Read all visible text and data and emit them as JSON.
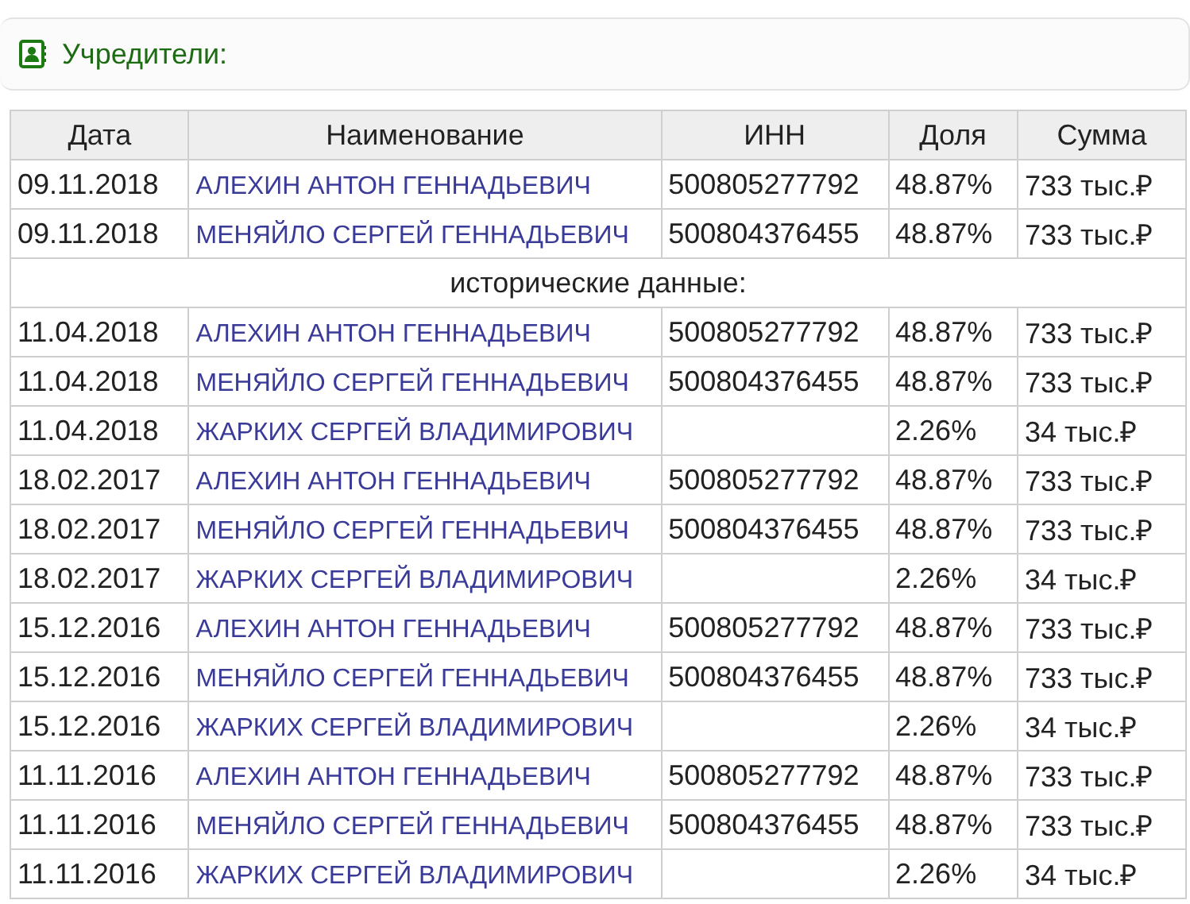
{
  "section": {
    "title": "Учредители:"
  },
  "table": {
    "columns": [
      "Дата",
      "Наименование",
      "ИНН",
      "Доля",
      "Сумма"
    ],
    "rows": [
      {
        "kind": "row",
        "date": "09.11.2018",
        "name": "АЛЕХИН АНТОН ГЕННАДЬЕВИЧ",
        "inn": "500805277792",
        "share": "48.87%",
        "sum": "733 тыс.₽"
      },
      {
        "kind": "row",
        "date": "09.11.2018",
        "name": "МЕНЯЙЛО СЕРГЕЙ ГЕННАДЬЕВИЧ",
        "inn": "500804376455",
        "share": "48.87%",
        "sum": "733 тыс.₽"
      },
      {
        "kind": "divider",
        "label": "исторические данные:"
      },
      {
        "kind": "row",
        "date": "11.04.2018",
        "name": "АЛЕХИН АНТОН ГЕННАДЬЕВИЧ",
        "inn": "500805277792",
        "share": "48.87%",
        "sum": "733 тыс.₽"
      },
      {
        "kind": "row",
        "date": "11.04.2018",
        "name": "МЕНЯЙЛО СЕРГЕЙ ГЕННАДЬЕВИЧ",
        "inn": "500804376455",
        "share": "48.87%",
        "sum": "733 тыс.₽"
      },
      {
        "kind": "row",
        "date": "11.04.2018",
        "name": "ЖАРКИХ СЕРГЕЙ ВЛАДИМИРОВИЧ",
        "share": "2.26%",
        "sum": "34 тыс.₽"
      },
      {
        "kind": "row",
        "date": "18.02.2017",
        "name": "АЛЕХИН АНТОН ГЕННАДЬЕВИЧ",
        "inn": "500805277792",
        "share": "48.87%",
        "sum": "733 тыс.₽"
      },
      {
        "kind": "row",
        "date": "18.02.2017",
        "name": "МЕНЯЙЛО СЕРГЕЙ ГЕННАДЬЕВИЧ",
        "inn": "500804376455",
        "share": "48.87%",
        "sum": "733 тыс.₽"
      },
      {
        "kind": "row",
        "date": "18.02.2017",
        "name": "ЖАРКИХ СЕРГЕЙ ВЛАДИМИРОВИЧ",
        "share": "2.26%",
        "sum": "34 тыс.₽"
      },
      {
        "kind": "row",
        "date": "15.12.2016",
        "name": "АЛЕХИН АНТОН ГЕННАДЬЕВИЧ",
        "inn": "500805277792",
        "share": "48.87%",
        "sum": "733 тыс.₽"
      },
      {
        "kind": "row",
        "date": "15.12.2016",
        "name": "МЕНЯЙЛО СЕРГЕЙ ГЕННАДЬЕВИЧ",
        "inn": "500804376455",
        "share": "48.87%",
        "sum": "733 тыс.₽"
      },
      {
        "kind": "row",
        "date": "15.12.2016",
        "name": "ЖАРКИХ СЕРГЕЙ ВЛАДИМИРОВИЧ",
        "share": "2.26%",
        "sum": "34 тыс.₽"
      },
      {
        "kind": "row",
        "date": "11.11.2016",
        "name": "АЛЕХИН АНТОН ГЕННАДЬЕВИЧ",
        "inn": "500805277792",
        "share": "48.87%",
        "sum": "733 тыс.₽"
      },
      {
        "kind": "row",
        "date": "11.11.2016",
        "name": "МЕНЯЙЛО СЕРГЕЙ ГЕННАДЬЕВИЧ",
        "inn": "500804376455",
        "share": "48.87%",
        "sum": "733 тыс.₽"
      },
      {
        "kind": "row",
        "date": "11.11.2016",
        "name": "ЖАРКИХ СЕРГЕЙ ВЛАДИМИРОВИЧ",
        "share": "2.26%",
        "sum": "34 тыс.₽"
      }
    ]
  }
}
